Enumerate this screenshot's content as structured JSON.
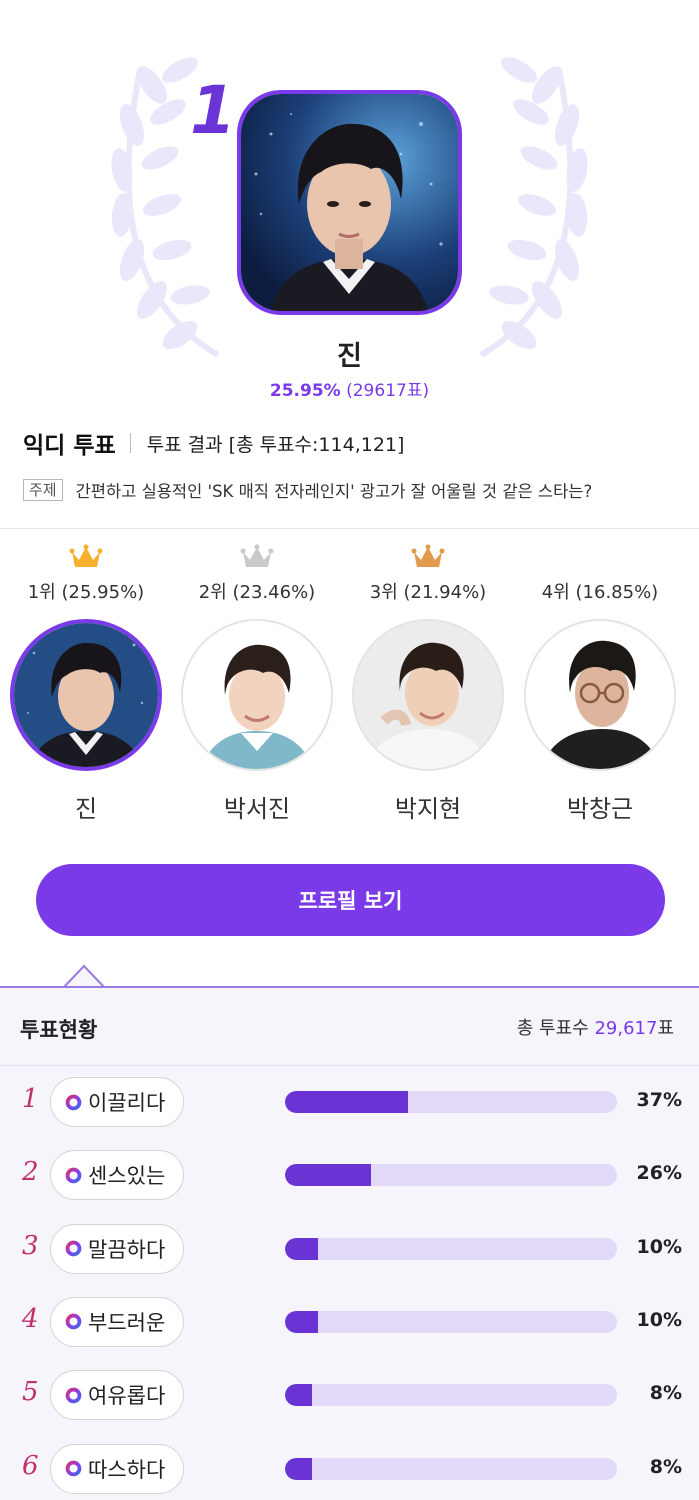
{
  "winner": {
    "rank": "1",
    "name": "진",
    "percent": "25.95%",
    "votes": "(29617표)"
  },
  "poll": {
    "title": "익디 투표",
    "result_text": "투표 결과 [총 투표수:114,121]",
    "topic_tag": "주제",
    "topic_text": "간편하고 실용적인 'SK 매직 전자레인지' 광고가 잘 어울릴 것 같은 스타는?"
  },
  "candidates": [
    {
      "rank_text": "1위 (25.95%)",
      "name": "진",
      "crown": "gold-crown-icon",
      "crown_color": "#f5b12e",
      "selected": true
    },
    {
      "rank_text": "2위 (23.46%)",
      "name": "박서진",
      "crown": "silver-crown-icon",
      "crown_color": "#c9c9c9",
      "selected": false
    },
    {
      "rank_text": "3위 (21.94%)",
      "name": "박지현",
      "crown": "bronze-crown-icon",
      "crown_color": "#e29a4d",
      "selected": false
    },
    {
      "rank_text": "4위 (16.85%)",
      "name": "박창근",
      "crown": "",
      "selected": false
    }
  ],
  "profile_button": "프로필 보기",
  "vote_status": {
    "title": "투표현황",
    "total_label": "총 투표수",
    "total_value": "29,617",
    "total_unit": "표",
    "items": [
      {
        "rank": "1",
        "label": "이끌리다",
        "percent": "37%",
        "fill": 0.37
      },
      {
        "rank": "2",
        "label": "센스있는",
        "percent": "26%",
        "fill": 0.26
      },
      {
        "rank": "3",
        "label": "말끔하다",
        "percent": "10%",
        "fill": 0.1
      },
      {
        "rank": "4",
        "label": "부드러운",
        "percent": "10%",
        "fill": 0.1
      },
      {
        "rank": "5",
        "label": "여유롭다",
        "percent": "8%",
        "fill": 0.08
      },
      {
        "rank": "6",
        "label": "따스하다",
        "percent": "8%",
        "fill": 0.08
      }
    ]
  },
  "colors": {
    "accent": "#7a3ae8",
    "bar_fill": "#6a34d4",
    "bar_track": "#e2d8f7",
    "rank_italic": "#c0306a"
  }
}
